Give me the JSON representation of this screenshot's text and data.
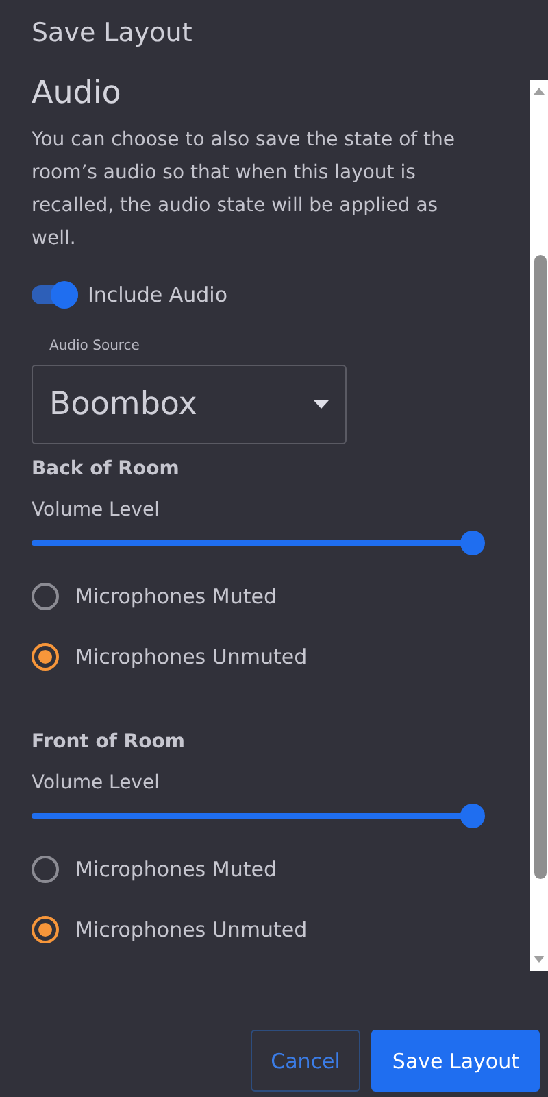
{
  "title": "Save Layout",
  "section": {
    "heading": "Audio",
    "description": "You can choose to also save the state of the room’s audio so that when this layout is recalled, the audio state will be applied as well."
  },
  "include_audio": {
    "label": "Include Audio",
    "on": true
  },
  "audio_source": {
    "label": "Audio Source",
    "value": "Boombox"
  },
  "zones": [
    {
      "name": "Back of Room",
      "volume_label": "Volume Level",
      "level": 1,
      "options": [
        {
          "label": "Microphones Muted",
          "selected": false
        },
        {
          "label": "Microphones Unmuted",
          "selected": true
        }
      ]
    },
    {
      "name": "Front of Room",
      "volume_label": "Volume Level",
      "level": 1,
      "options": [
        {
          "label": "Microphones Muted",
          "selected": false
        },
        {
          "label": "Microphones Unmuted",
          "selected": true
        }
      ]
    }
  ],
  "buttons": [
    {
      "label": "Cancel",
      "kind": "secondary"
    },
    {
      "label": "Save Layout",
      "kind": "primary"
    }
  ]
}
